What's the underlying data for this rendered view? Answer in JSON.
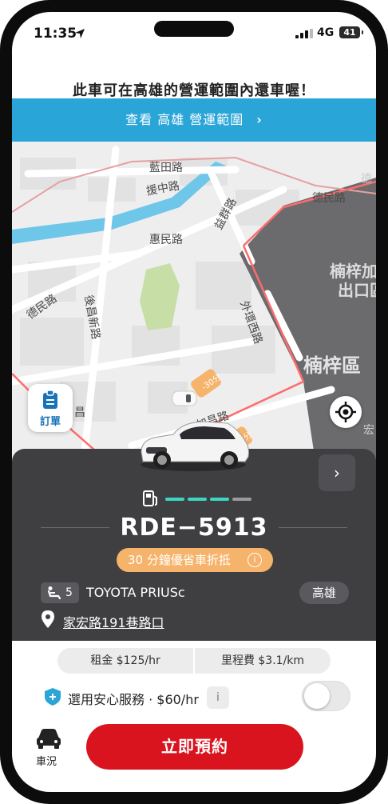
{
  "status_bar": {
    "time": "11:35",
    "network": "4G",
    "battery": "41"
  },
  "headline": "此車可在高雄的營運範圍內還車喔！",
  "zone_banner": {
    "label": "查看 高雄 營運範圍",
    "chevron": "›"
  },
  "map": {
    "labels": [
      "藍田路",
      "援中路",
      "益群路",
      "德民路",
      "惠民路",
      "楠梓加",
      "出口區",
      "後昌新路",
      "德民路",
      "外環西路",
      "楠梓區",
      "加昌路",
      "昌",
      "宏",
      "德"
    ],
    "car_markers": [
      "-30分",
      "-30分"
    ]
  },
  "order_button": {
    "label": "訂單",
    "icon": "clipboard-icon"
  },
  "locate_button": {
    "icon": "crosshair-icon"
  },
  "car_card": {
    "plate": "RDE−5913",
    "promo": "30 分鐘優省車折抵",
    "promo_info": "i",
    "seats": "5",
    "model": "TOYOTA PRIUSc",
    "city": "高雄",
    "address": "家宏路191巷路口",
    "next": "›",
    "fuel_level": 0.75,
    "accent": "#3bd6c6"
  },
  "fees": {
    "rent": "租金 $125/hr",
    "mileage": "里程費 $3.1/km"
  },
  "insurance": {
    "label": "選用安心服務 · $60/hr",
    "info": "i",
    "enabled": false
  },
  "bottom": {
    "status_label": "車況",
    "book_label": "立即預約",
    "book_color": "#d9141e"
  }
}
